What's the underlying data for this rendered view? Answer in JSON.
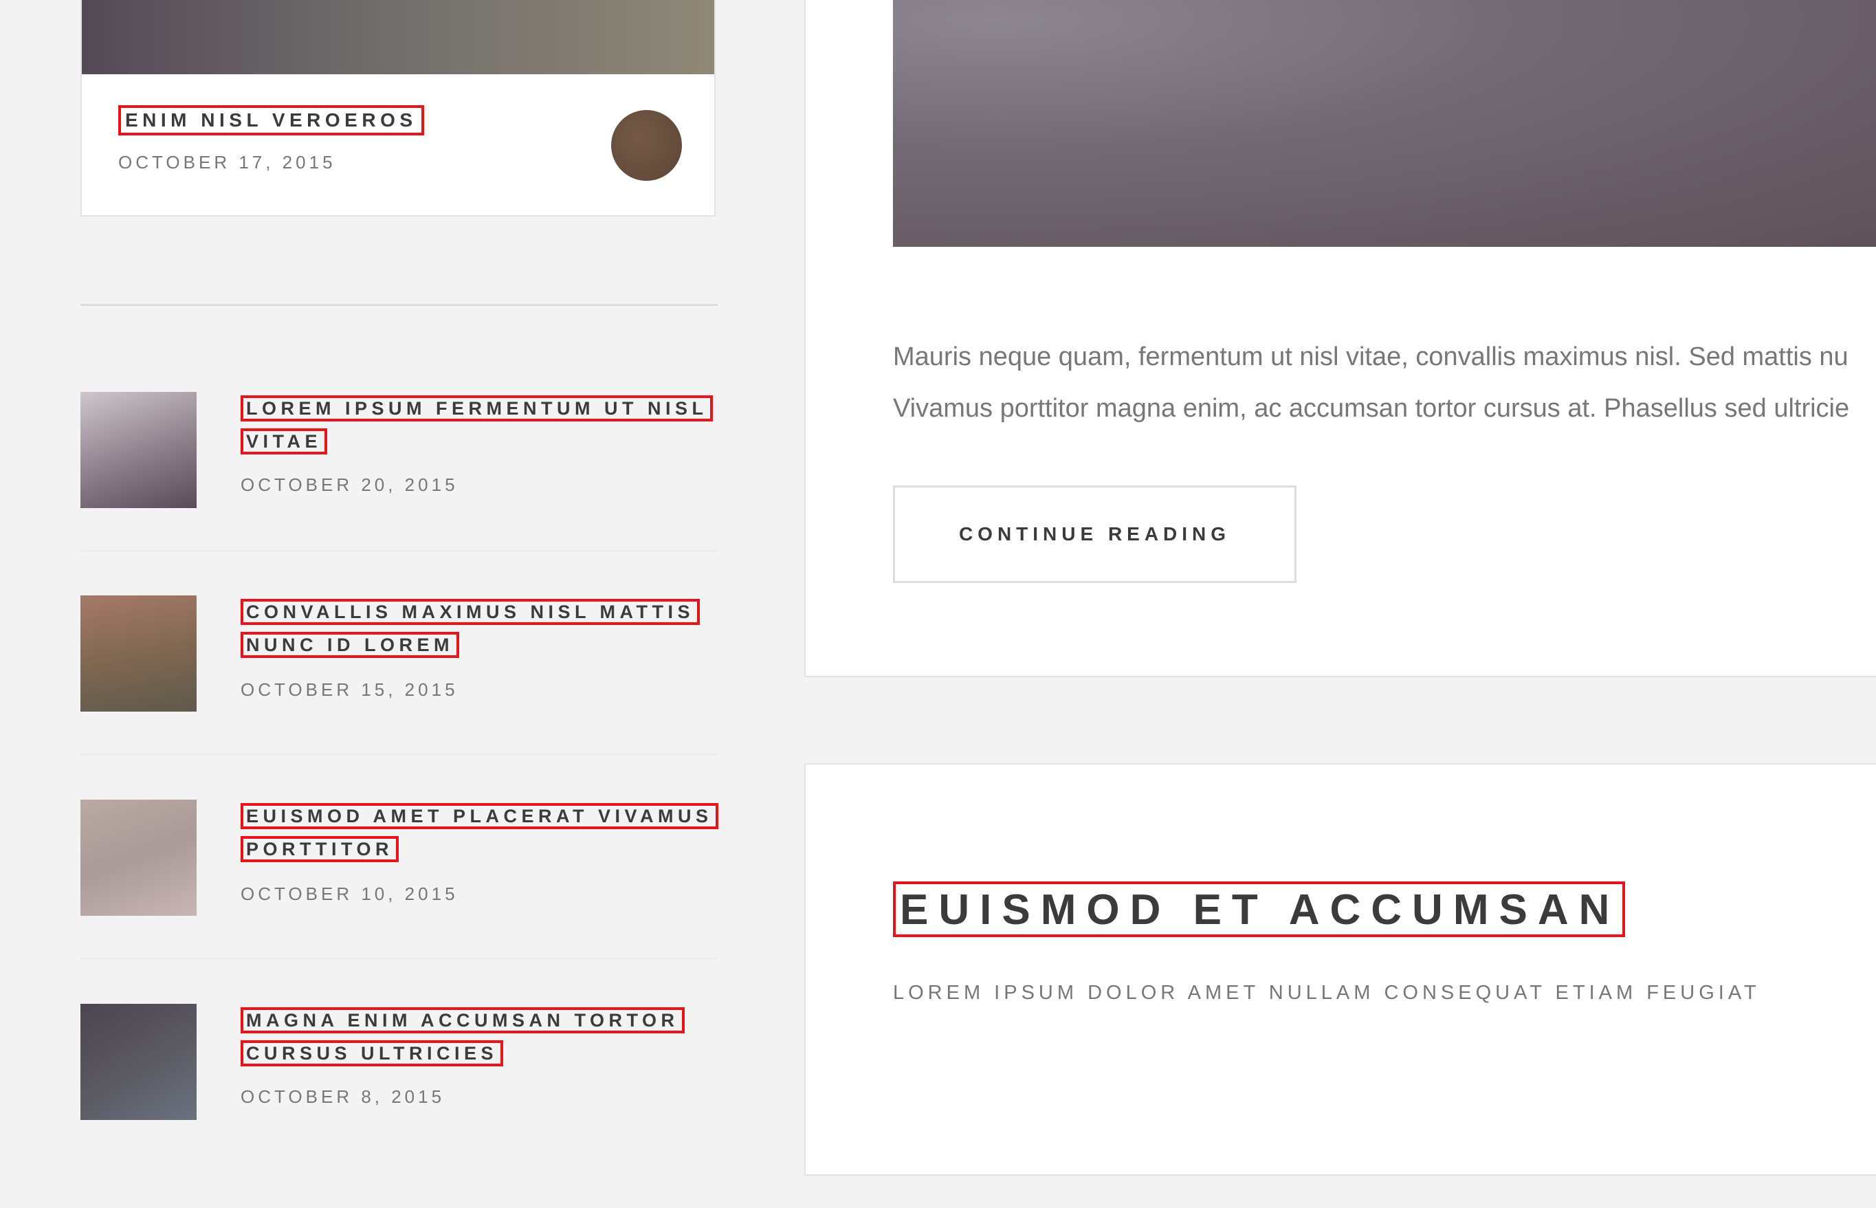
{
  "sidebar": {
    "featured": {
      "title": "ENIM NISL VEROEROS",
      "date": "OCTOBER 17, 2015"
    },
    "posts": [
      {
        "title": "LOREM IPSUM FERMENTUM UT NISL VITAE",
        "date": "OCTOBER 20, 2015",
        "thumb_colors": [
          "#cfc6cc",
          "#594b58"
        ]
      },
      {
        "title": "CONVALLIS MAXIMUS NISL MATTIS NUNC ID LOREM",
        "date": "OCTOBER 15, 2015",
        "thumb_colors": [
          "#a57a66",
          "#5e5a4c"
        ]
      },
      {
        "title": "EUISMOD AMET PLACERAT VIVAMUS PORTTITOR",
        "date": "OCTOBER 10, 2015",
        "thumb_colors": [
          "#b9aaa2",
          "#c8b6b5"
        ]
      },
      {
        "title": "MAGNA ENIM ACCUMSAN TORTOR CURSUS ULTRICIES",
        "date": "OCTOBER 8, 2015",
        "thumb_colors": [
          "#4c4550",
          "#697380"
        ]
      }
    ]
  },
  "main": {
    "excerpt_lines": [
      "Mauris neque quam, fermentum ut nisl vitae, convallis maximus nisl. Sed mattis nu",
      "Vivamus porttitor magna enim, ac accumsan tortor cursus at. Phasellus sed ultricie"
    ],
    "continue_label": "CONTINUE READING",
    "next_article": {
      "title": "EUISMOD ET ACCUMSAN",
      "subtitle": "LOREM IPSUM DOLOR AMET NULLAM CONSEQUAT ETIAM FEUGIAT"
    }
  },
  "colors": {
    "page_bg": "#f3f3f3",
    "card_bg": "#ffffff",
    "text_dark": "#3c3b3b",
    "text_muted": "#777777",
    "highlight": "#e8141b"
  }
}
